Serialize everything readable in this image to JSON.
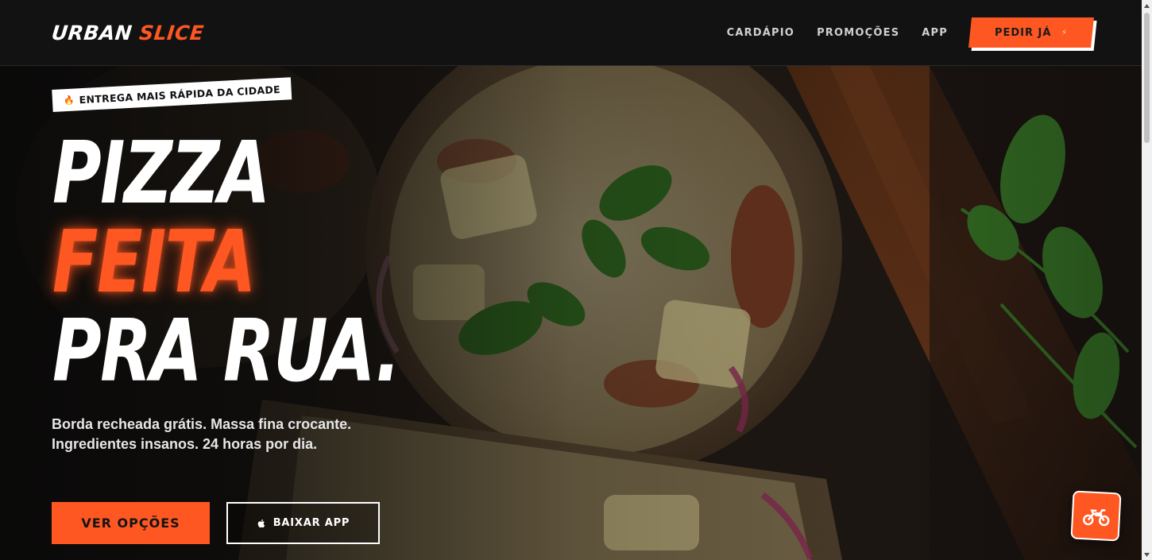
{
  "header": {
    "logo_part1": "URBAN",
    "logo_part2": "SLICE",
    "nav": [
      {
        "label": "CARDÁPIO"
      },
      {
        "label": "PROMOÇÕES"
      },
      {
        "label": "APP"
      }
    ],
    "order_button": {
      "label": "PEDIR JÁ",
      "icon": "bolt-icon"
    }
  },
  "hero": {
    "badge": {
      "icon": "fire-icon",
      "label": "ENTREGA MAIS RÁPIDA DA CIDADE"
    },
    "headline": {
      "line1": "PIZZA",
      "line2": "FEITA",
      "line3": "PRA RUA."
    },
    "subtitle": "Borda recheada grátis. Massa fina crocante. Ingredientes insanos. 24 horas por dia.",
    "primary_button": "VER OPÇÕES",
    "secondary_button": {
      "label": "BAIXAR APP",
      "icon": "apple-icon"
    }
  },
  "floating_button": {
    "icon": "motorcycle-icon"
  },
  "colors": {
    "accent": "#ff5722",
    "header_bg": "#121212",
    "text": "#ffffff"
  }
}
